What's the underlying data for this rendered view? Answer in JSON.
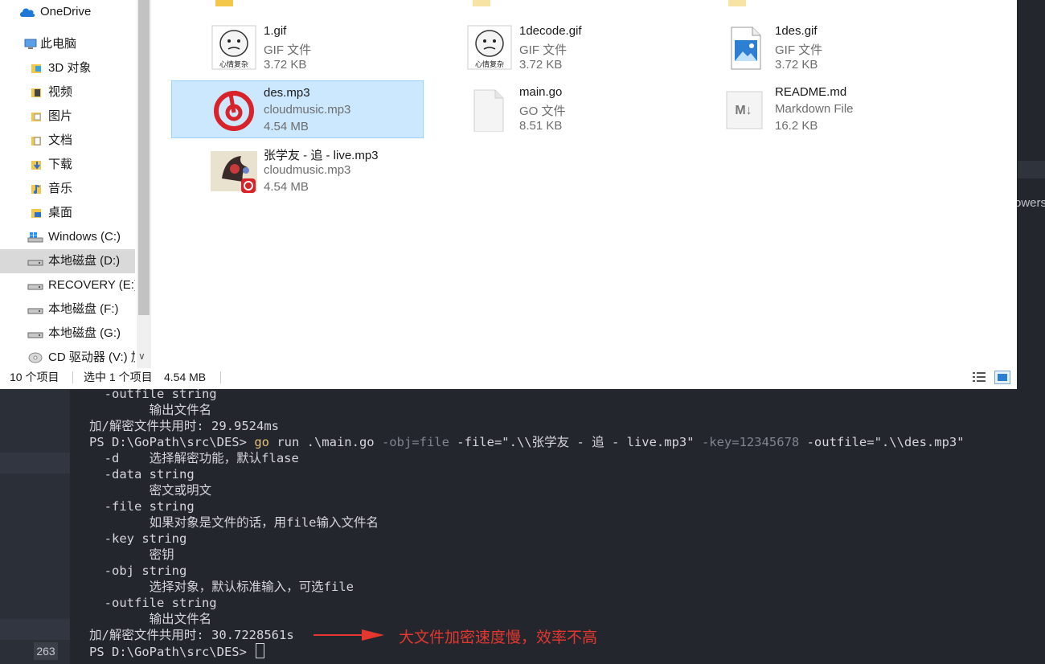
{
  "nav": {
    "items": [
      {
        "label": "OneDrive",
        "icon": "cloud-icon"
      },
      {
        "label": "此电脑",
        "icon": "computer-icon"
      },
      {
        "label": "3D 对象",
        "icon": "3d-objects-icon"
      },
      {
        "label": "视频",
        "icon": "video-folder-icon"
      },
      {
        "label": "图片",
        "icon": "pictures-folder-icon"
      },
      {
        "label": "文档",
        "icon": "documents-folder-icon"
      },
      {
        "label": "下载",
        "icon": "downloads-folder-icon"
      },
      {
        "label": "音乐",
        "icon": "music-folder-icon"
      },
      {
        "label": "桌面",
        "icon": "desktop-folder-icon"
      },
      {
        "label": "Windows (C:)",
        "icon": "windows-drive-icon"
      },
      {
        "label": "本地磁盘 (D:)",
        "icon": "drive-icon"
      },
      {
        "label": "RECOVERY (E:)",
        "icon": "drive-icon"
      },
      {
        "label": "本地磁盘 (F:)",
        "icon": "drive-icon"
      },
      {
        "label": "本地磁盘 (G:)",
        "icon": "drive-icon"
      },
      {
        "label": "CD 驱动器 (V:) 加",
        "icon": "cd-drive-icon"
      }
    ]
  },
  "files": [
    {
      "name": "1.gif",
      "type": "GIF 文件",
      "size": "3.72 KB",
      "thumb": "meme-thumbnail",
      "caption": "心情复杂"
    },
    {
      "name": "1decode.gif",
      "type": "GIF 文件",
      "size": "3.72 KB",
      "thumb": "meme-thumbnail",
      "caption": "心情复杂"
    },
    {
      "name": "1des.gif",
      "type": "GIF 文件",
      "size": "3.72 KB",
      "thumb": "image-file-icon"
    },
    {
      "name": "des.mp3",
      "type": "cloudmusic.mp3",
      "size": "4.54 MB",
      "thumb": "netease-music-icon"
    },
    {
      "name": "main.go",
      "type": "GO 文件",
      "size": "8.51 KB",
      "thumb": "blank-file-icon"
    },
    {
      "name": "README.md",
      "type": "Markdown File",
      "size": "16.2 KB",
      "thumb": "markdown-file-icon"
    },
    {
      "name": "张学友 - 追 - live.mp3",
      "type": "cloudmusic.mp3",
      "size": "4.54 MB",
      "thumb": "album-art-thumbnail"
    }
  ],
  "status": {
    "count": "10 个项目",
    "selected": "选中 1 个项目",
    "selected_size": "4.54 MB"
  },
  "terminal": {
    "line_number": "263",
    "right_fragment": "owers",
    "lines": [
      "  -outfile string",
      "        输出文件名",
      "加/解密文件共用时: 29.9524ms",
      "",
      "  -d    选择解密功能，默认flase",
      "  -data string",
      "        密文或明文",
      "  -file string",
      "        如果对象是文件的话，用file输入文件名",
      "  -key string",
      "        密钥",
      "  -obj string",
      "        选择对象，默认标准输入，可选file",
      "  -outfile string",
      "        输出文件名",
      "加/解密文件共用时: 30.7228561s",
      "PS D:\\GoPath\\src\\DES> "
    ],
    "cmd": {
      "prompt": "PS D:\\GoPath\\src\\DES> ",
      "go": "go",
      "run": " run .\\main.go ",
      "obj": "-obj=file",
      "file": " -file=\".\\\\张学友 - 追 - live.mp3\" ",
      "key": "-key=12345678",
      "outfile": " -outfile=\".\\\\des.mp3\""
    }
  },
  "annotation": "大文件加密速度慢，效率不高",
  "colors": {
    "accent": "#e5372f",
    "selection": "#cce8ff",
    "terminal_bg": "#23262d"
  }
}
